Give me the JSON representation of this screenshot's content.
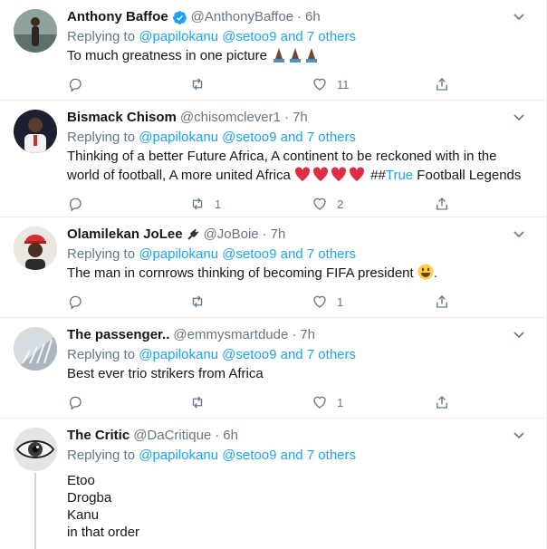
{
  "tweets": [
    {
      "name": "Anthony Baffoe",
      "handle": "@AnthonyBaffoe",
      "time": "6h",
      "reply_prefix": "Replying to",
      "reply_to": "@papilokanu @setoo9 and 7 others",
      "text": "To much greatness in one picture ",
      "replies": "",
      "retweets": "",
      "likes": "11",
      "avatar_color": "#7a8f8c"
    },
    {
      "name": "Bismack Chisom",
      "handle": "@chisomclever1",
      "time": "7h",
      "reply_prefix": "Replying to",
      "reply_to": "@papilokanu @setoo9 and 7 others",
      "text_1": "Thinking of a better Future Africa, A continent to be reckoned with in the",
      "text_2": "world of football, A more united Africa",
      "text_3": " ##",
      "text_hashtag": "True",
      "text_4": " Football Legends",
      "replies": "",
      "retweets": "1",
      "likes": "2",
      "avatar_color": "#1c2333"
    },
    {
      "name": "Olamilekan JoLee",
      "handle": "@JoBoie",
      "time": "7h",
      "reply_prefix": "Replying to",
      "reply_to": "@papilokanu @setoo9 and 7 others",
      "text": "The man in cornrows thinking of becoming FIFA president ",
      "text_end": ".",
      "replies": "",
      "retweets": "",
      "likes": "1",
      "avatar_color": "#e7e2da"
    },
    {
      "name": "The passenger..",
      "handle": "@emmysmartdude",
      "time": "7h",
      "reply_prefix": "Replying to",
      "reply_to": "@papilokanu @setoo9 and 7 others",
      "text": "Best ever trio strikers from Africa",
      "replies": "",
      "retweets": "",
      "likes": "1",
      "avatar_color": "#b7c3cc"
    },
    {
      "name": "The Critic",
      "handle": "@DaCritique",
      "time": "6h",
      "reply_prefix": "Replying to",
      "reply_to": "@papilokanu @setoo9 and 7 others",
      "lines": [
        "Etoo",
        "Drogba",
        "Kanu",
        "in that order"
      ],
      "avatar_color": "#d9d9d9"
    }
  ],
  "dot": "·",
  "colors": {
    "link": "#1da1f2",
    "muted": "#657786",
    "heart": "#e0245e",
    "verified": "#1da1f2"
  }
}
